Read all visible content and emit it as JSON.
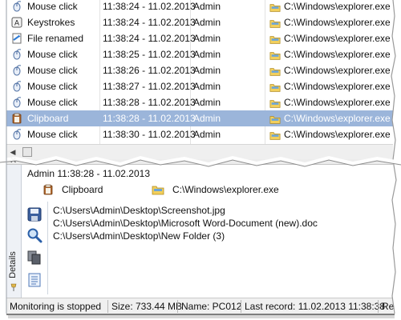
{
  "log": {
    "rows": [
      {
        "event": "Mouse click",
        "time": "11:38:24 - 11.02.2013",
        "user": "Admin",
        "app": "C:\\Windows\\explorer.exe",
        "icon": "mouse-icon",
        "selected": false
      },
      {
        "event": "Keystrokes",
        "time": "11:38:24 - 11.02.2013",
        "user": "Admin",
        "app": "C:\\Windows\\explorer.exe",
        "icon": "keyboard-icon",
        "selected": false
      },
      {
        "event": "File renamed",
        "time": "11:38:24 - 11.02.2013",
        "user": "Admin",
        "app": "C:\\Windows\\explorer.exe",
        "icon": "file-icon",
        "selected": false
      },
      {
        "event": "Mouse click",
        "time": "11:38:25 - 11.02.2013",
        "user": "Admin",
        "app": "C:\\Windows\\explorer.exe",
        "icon": "mouse-icon",
        "selected": false
      },
      {
        "event": "Mouse click",
        "time": "11:38:26 - 11.02.2013",
        "user": "Admin",
        "app": "C:\\Windows\\explorer.exe",
        "icon": "mouse-icon",
        "selected": false
      },
      {
        "event": "Mouse click",
        "time": "11:38:27 - 11.02.2013",
        "user": "Admin",
        "app": "C:\\Windows\\explorer.exe",
        "icon": "mouse-icon",
        "selected": false
      },
      {
        "event": "Mouse click",
        "time": "11:38:28 - 11.02.2013",
        "user": "Admin",
        "app": "C:\\Windows\\explorer.exe",
        "icon": "mouse-icon",
        "selected": false
      },
      {
        "event": "Clipboard",
        "time": "11:38:28 - 11.02.2013",
        "user": "Admin",
        "app": "C:\\Windows\\explorer.exe",
        "icon": "clipboard-icon",
        "selected": true
      },
      {
        "event": "Mouse click",
        "time": "11:38:30 - 11.02.2013",
        "user": "Admin",
        "app": "C:\\Windows\\explorer.exe",
        "icon": "mouse-icon",
        "selected": false
      }
    ],
    "selected_color": "#9bb5da"
  },
  "details": {
    "tab_label": "Details",
    "header": "Admin  11:38:28 - 11.02.2013",
    "event": "Clipboard",
    "app": "C:\\Windows\\explorer.exe",
    "lines": [
      "C:\\Users\\Admin\\Desktop\\Screenshot.jpg",
      "C:\\Users\\Admin\\Desktop\\Microsoft Word-Document (new).doc",
      "C:\\Users\\Admin\\Desktop\\New Folder (3)"
    ],
    "toolbar": [
      "save-icon",
      "search-icon",
      "copy-icon",
      "document-icon"
    ]
  },
  "status": {
    "monitoring": "Monitoring is stopped",
    "size": "Size: 733.44 MB",
    "name": "Name: PC012",
    "last_record": "Last record: 11.02.2013 11:38:38",
    "extra": "Re"
  }
}
